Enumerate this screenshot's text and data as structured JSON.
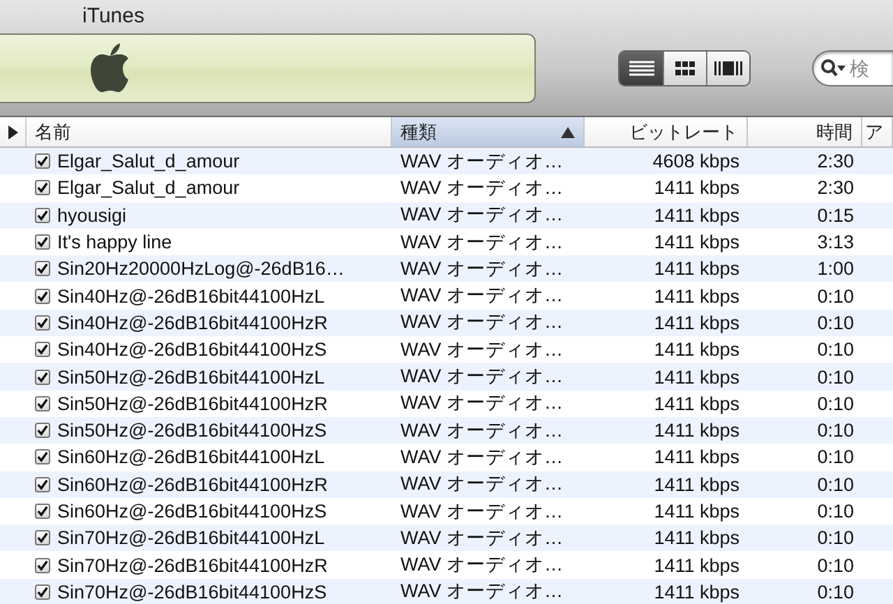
{
  "window": {
    "title": "iTunes"
  },
  "view_buttons": [
    {
      "kind": "list",
      "selected": true
    },
    {
      "kind": "grid",
      "selected": false
    },
    {
      "kind": "coverflow",
      "selected": false
    }
  ],
  "search": {
    "placeholder": "検"
  },
  "table": {
    "columns": [
      {
        "label": "名前",
        "selected": false
      },
      {
        "label": "種類",
        "selected": true
      },
      {
        "label": "ビットレート",
        "selected": false
      },
      {
        "label": "時間",
        "selected": false
      },
      {
        "label": "ア",
        "selected": false
      }
    ],
    "rows": [
      {
        "checked": true,
        "name": "Elgar_Salut_d_amour",
        "kind": "WAV オーディオ…",
        "bitrate": "4608 kbps",
        "time": "2:30"
      },
      {
        "checked": true,
        "name": "Elgar_Salut_d_amour",
        "kind": "WAV オーディオ…",
        "bitrate": "1411 kbps",
        "time": "2:30"
      },
      {
        "checked": true,
        "name": "hyousigi",
        "kind": "WAV オーディオ…",
        "bitrate": "1411 kbps",
        "time": "0:15"
      },
      {
        "checked": true,
        "name": "It's happy line",
        "kind": "WAV オーディオ…",
        "bitrate": "1411 kbps",
        "time": "3:13"
      },
      {
        "checked": true,
        "name": "Sin20Hz20000HzLog@-26dB16…",
        "kind": "WAV オーディオ…",
        "bitrate": "1411 kbps",
        "time": "1:00"
      },
      {
        "checked": true,
        "name": "Sin40Hz@-26dB16bit44100HzL",
        "kind": "WAV オーディオ…",
        "bitrate": "1411 kbps",
        "time": "0:10"
      },
      {
        "checked": true,
        "name": "Sin40Hz@-26dB16bit44100HzR",
        "kind": "WAV オーディオ…",
        "bitrate": "1411 kbps",
        "time": "0:10"
      },
      {
        "checked": true,
        "name": "Sin40Hz@-26dB16bit44100HzS",
        "kind": "WAV オーディオ…",
        "bitrate": "1411 kbps",
        "time": "0:10"
      },
      {
        "checked": true,
        "name": "Sin50Hz@-26dB16bit44100HzL",
        "kind": "WAV オーディオ…",
        "bitrate": "1411 kbps",
        "time": "0:10"
      },
      {
        "checked": true,
        "name": "Sin50Hz@-26dB16bit44100HzR",
        "kind": "WAV オーディオ…",
        "bitrate": "1411 kbps",
        "time": "0:10"
      },
      {
        "checked": true,
        "name": "Sin50Hz@-26dB16bit44100HzS",
        "kind": "WAV オーディオ…",
        "bitrate": "1411 kbps",
        "time": "0:10"
      },
      {
        "checked": true,
        "name": "Sin60Hz@-26dB16bit44100HzL",
        "kind": "WAV オーディオ…",
        "bitrate": "1411 kbps",
        "time": "0:10"
      },
      {
        "checked": true,
        "name": "Sin60Hz@-26dB16bit44100HzR",
        "kind": "WAV オーディオ…",
        "bitrate": "1411 kbps",
        "time": "0:10"
      },
      {
        "checked": true,
        "name": "Sin60Hz@-26dB16bit44100HzS",
        "kind": "WAV オーディオ…",
        "bitrate": "1411 kbps",
        "time": "0:10"
      },
      {
        "checked": true,
        "name": "Sin70Hz@-26dB16bit44100HzL",
        "kind": "WAV オーディオ…",
        "bitrate": "1411 kbps",
        "time": "0:10"
      },
      {
        "checked": true,
        "name": "Sin70Hz@-26dB16bit44100HzR",
        "kind": "WAV オーディオ…",
        "bitrate": "1411 kbps",
        "time": "0:10"
      },
      {
        "checked": true,
        "name": "Sin70Hz@-26dB16bit44100HzS",
        "kind": "WAV オーディオ…",
        "bitrate": "1411 kbps",
        "time": "0:10"
      }
    ]
  }
}
